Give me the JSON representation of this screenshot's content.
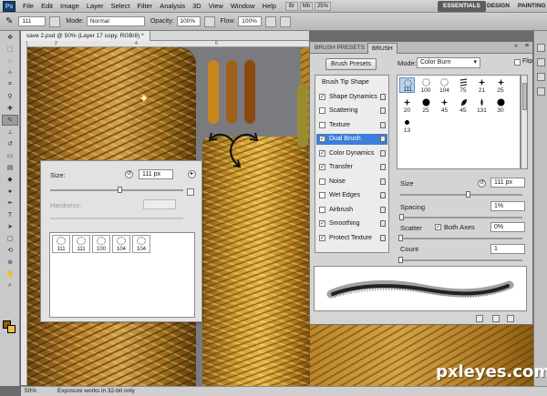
{
  "menubar": {
    "logo": "Ps",
    "items": [
      "File",
      "Edit",
      "Image",
      "Layer",
      "Select",
      "Filter",
      "Analysis",
      "3D",
      "View",
      "Window",
      "Help"
    ],
    "icon_labels": [
      "Br",
      "Mb",
      "25%"
    ],
    "workspaces": [
      "ESSENTIALS",
      "DESIGN",
      "PAINTING"
    ],
    "active_workspace": "ESSENTIALS"
  },
  "options": {
    "brush_size": "111",
    "mode_label": "Mode:",
    "mode_value": "Normal",
    "opacity_label": "Opacity:",
    "opacity_value": "100%",
    "flow_label": "Flow:",
    "flow_value": "100%"
  },
  "document": {
    "tab_title": "save 2.psd @ 50% (Layer 17 copy, RGB/8) *",
    "ruler_ticks": [
      "2",
      "4",
      "6"
    ]
  },
  "status": {
    "zoom": "50%",
    "message": "Exposure works in 32-bit only"
  },
  "watermark": "pxleyes.com",
  "canvas": {
    "swatch_colors": [
      "#c6861c",
      "#a0601a",
      "#8c4a10",
      "#9a8a30"
    ]
  },
  "brush_picker": {
    "size_label": "Size:",
    "size_value": "111 px",
    "hardness_label": "Hardness:",
    "size_fraction": 0.52,
    "tips": [
      "111",
      "111",
      "100",
      "104",
      "104"
    ]
  },
  "brush_panel": {
    "tabs": [
      "BRUSH PRESETS",
      "BRUSH"
    ],
    "active_tab": "BRUSH",
    "presets_button": "Brush Presets",
    "mode_label": "Mode:",
    "mode_value": "Color Burn",
    "flip_label": "Flip",
    "options": [
      {
        "label": "Brush Tip Shape",
        "checked": null,
        "header": true
      },
      {
        "label": "Shape Dynamics",
        "checked": true
      },
      {
        "label": "Scattering",
        "checked": false
      },
      {
        "label": "Texture",
        "checked": false
      },
      {
        "label": "Dual Brush",
        "checked": true,
        "selected": true
      },
      {
        "label": "Color Dynamics",
        "checked": true
      },
      {
        "label": "Transfer",
        "checked": true
      },
      {
        "label": "Noise",
        "checked": false
      },
      {
        "label": "Wet Edges",
        "checked": false
      },
      {
        "label": "Airbrush",
        "checked": false
      },
      {
        "label": "Smoothing",
        "checked": true
      },
      {
        "label": "Protect Texture",
        "checked": true
      }
    ],
    "tip_grid": [
      {
        "num": "111",
        "kind": "dot-outline",
        "selected": true
      },
      {
        "num": "100",
        "kind": "dot-outline"
      },
      {
        "num": "104",
        "kind": "dot-outline"
      },
      {
        "num": "75",
        "kind": "hatch"
      },
      {
        "num": "21",
        "kind": "star"
      },
      {
        "num": "25",
        "kind": "star"
      },
      {
        "num": "20",
        "kind": "star"
      },
      {
        "num": "25",
        "kind": "solid"
      },
      {
        "num": "45",
        "kind": "star"
      },
      {
        "num": "45",
        "kind": "leaf"
      },
      {
        "num": "131",
        "kind": "drop"
      },
      {
        "num": "30",
        "kind": "solid"
      },
      {
        "num": "13",
        "kind": "solid-small"
      }
    ],
    "size_label": "Size",
    "size_value": "111 px",
    "size_fraction": 0.55,
    "spacing_label": "Spacing",
    "spacing_value": "1%",
    "spacing_fraction": 0.01,
    "scatter_label": "Scatter",
    "both_axes_label": "Both Axes",
    "both_axes_checked": true,
    "scatter_value": "0%",
    "scatter_fraction": 0.0,
    "count_label": "Count",
    "count_value": "1",
    "count_fraction": 0.0
  }
}
